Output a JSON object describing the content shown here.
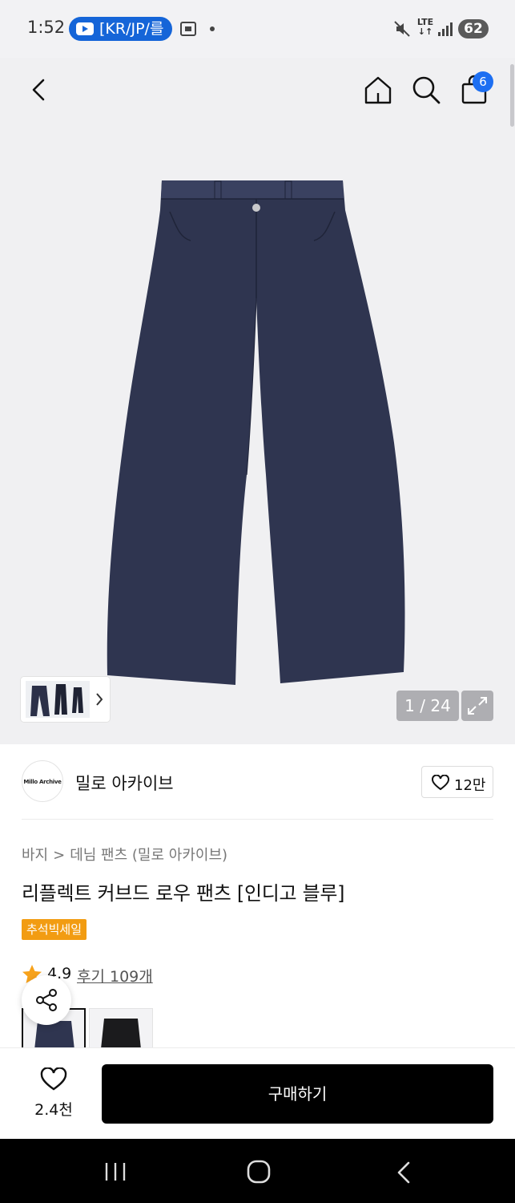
{
  "status_bar": {
    "time": "1:52",
    "notification_pill": "[KR/JP/를",
    "network": "LTE",
    "battery": "62"
  },
  "top_nav": {
    "cart_badge": "6"
  },
  "gallery": {
    "page_counter": "1 / 24"
  },
  "brand": {
    "logo_text": "Millo Archive",
    "name": "밀로 아카이브",
    "likes": "12만"
  },
  "product": {
    "breadcrumb": [
      "바지",
      "데님 팬츠 (밀로 아카이브)"
    ],
    "breadcrumb_sep": ">",
    "title": "리플렉트 커브드 로우 팬츠 [인디고 블루]",
    "sale_badge": "추석빅세일",
    "rating": "4.9",
    "reviews": "후기 109개"
  },
  "action_bar": {
    "wish_count": "2.4천",
    "buy_label": "구매하기"
  },
  "colors": {
    "brand_blue": "#1d6ff2",
    "sale_orange": "#f29c12",
    "star": "#f7a21b",
    "denim": "#2f3550"
  },
  "icons": [
    "back-icon",
    "home-icon",
    "search-icon",
    "cart-icon",
    "expand-icon",
    "heart-icon",
    "star-icon",
    "share-icon"
  ]
}
